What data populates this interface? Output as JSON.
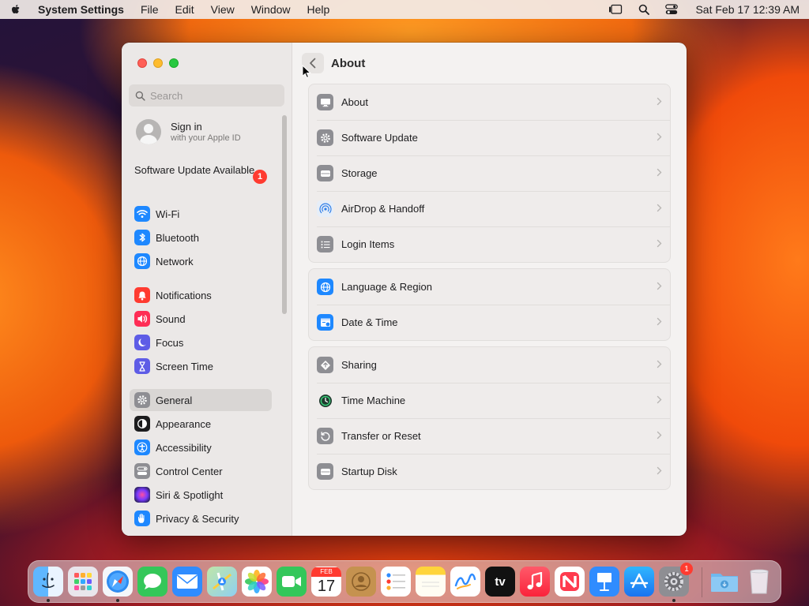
{
  "menubar": {
    "app_name": "System Settings",
    "menus": [
      "File",
      "Edit",
      "View",
      "Window",
      "Help"
    ],
    "clock": "Sat Feb 17  12:39 AM"
  },
  "sidebar": {
    "search_placeholder": "Search",
    "signin_title": "Sign in",
    "signin_subtitle": "with your Apple ID",
    "software_update_label": "Software Update Available",
    "software_update_badge": "1",
    "items": [
      {
        "label": "Wi-Fi",
        "icon": "wifi-icon",
        "color": "#1e88ff"
      },
      {
        "label": "Bluetooth",
        "icon": "bluetooth-icon",
        "color": "#1e88ff"
      },
      {
        "label": "Network",
        "icon": "globe-icon",
        "color": "#1e88ff"
      },
      {
        "label": "Notifications",
        "icon": "bell-icon",
        "color": "#ff3b30"
      },
      {
        "label": "Sound",
        "icon": "speaker-icon",
        "color": "#ff2d55"
      },
      {
        "label": "Focus",
        "icon": "moon-icon",
        "color": "#5e5ce6"
      },
      {
        "label": "Screen Time",
        "icon": "hourglass-icon",
        "color": "#5e5ce6"
      },
      {
        "label": "General",
        "icon": "gear-icon",
        "color": "#8e8e93"
      },
      {
        "label": "Appearance",
        "icon": "appearance-icon",
        "color": "#1c1c1e"
      },
      {
        "label": "Accessibility",
        "icon": "accessibility-icon",
        "color": "#1e88ff"
      },
      {
        "label": "Control Center",
        "icon": "control-center-icon",
        "color": "#8e8e93"
      },
      {
        "label": "Siri & Spotlight",
        "icon": "siri-icon",
        "color": "#6b3fd6"
      },
      {
        "label": "Privacy & Security",
        "icon": "hand-icon",
        "color": "#1e88ff"
      }
    ],
    "selected": "General"
  },
  "content": {
    "title": "About",
    "groups": [
      [
        {
          "label": "About",
          "icon": "display-icon"
        },
        {
          "label": "Software Update",
          "icon": "gear-icon"
        },
        {
          "label": "Storage",
          "icon": "drive-icon"
        },
        {
          "label": "AirDrop & Handoff",
          "icon": "airdrop-icon"
        },
        {
          "label": "Login Items",
          "icon": "list-icon"
        }
      ],
      [
        {
          "label": "Language & Region",
          "icon": "globe-icon"
        },
        {
          "label": "Date & Time",
          "icon": "calendar-icon"
        }
      ],
      [
        {
          "label": "Sharing",
          "icon": "sharing-icon"
        },
        {
          "label": "Time Machine",
          "icon": "time-machine-icon"
        },
        {
          "label": "Transfer or Reset",
          "icon": "reset-icon"
        },
        {
          "label": "Startup Disk",
          "icon": "drive-icon"
        }
      ]
    ]
  },
  "dock": {
    "calendar_month": "FEB",
    "calendar_day": "17",
    "tv_label": "tv",
    "settings_badge": "1",
    "apps": [
      "Finder",
      "Launchpad",
      "Safari",
      "Messages",
      "Mail",
      "Maps",
      "Photos",
      "FaceTime",
      "Calendar",
      "Contacts",
      "Reminders",
      "Notes",
      "Freeform",
      "TV",
      "Music",
      "News",
      "Keynote",
      "App Store",
      "System Settings",
      "Downloads",
      "Trash"
    ]
  }
}
